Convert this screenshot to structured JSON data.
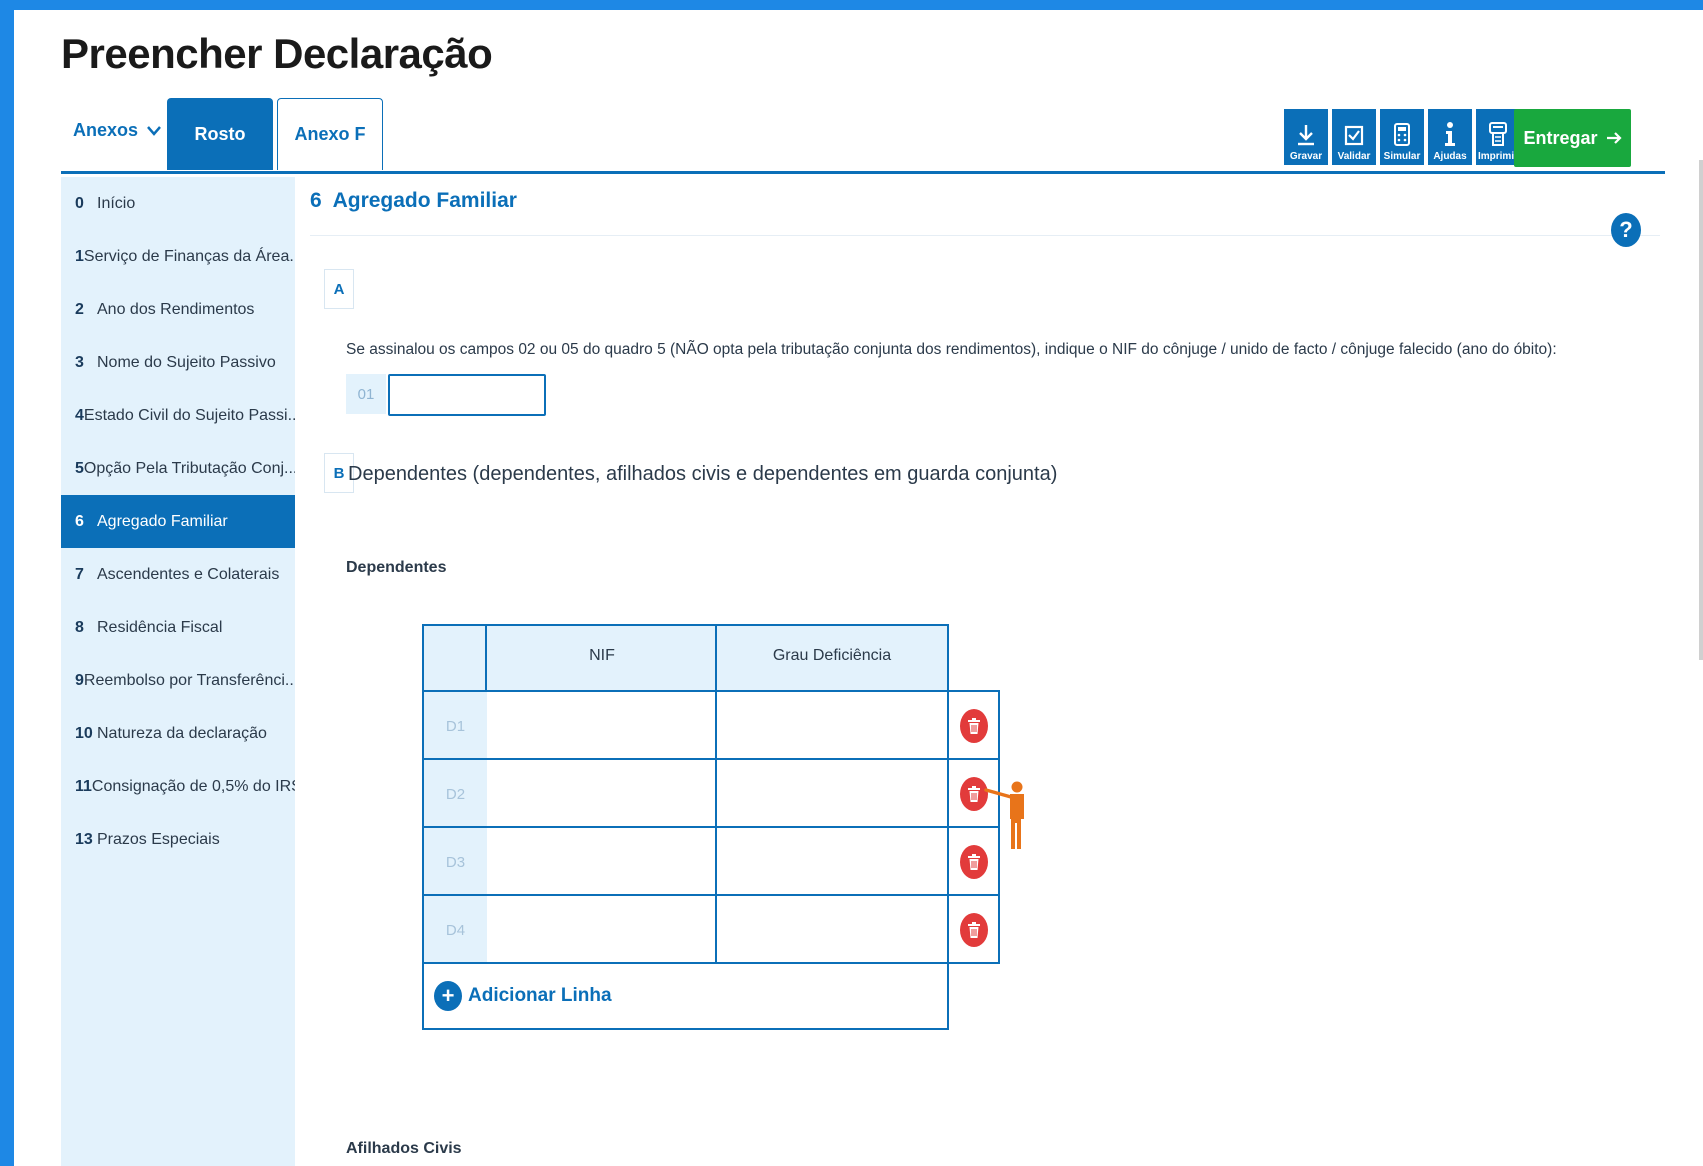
{
  "page": {
    "title": "Preencher Declaração"
  },
  "tabs": {
    "anexos_label": "Anexos",
    "rosto_label": "Rosto",
    "anexo_f_label": "Anexo F"
  },
  "toolbar": {
    "gravar": "Gravar",
    "validar": "Validar",
    "simular": "Simular",
    "ajudas": "Ajudas",
    "imprimir": "Imprimir",
    "entregar": "Entregar"
  },
  "sidebar": {
    "items": [
      {
        "num": "0",
        "label": "Início"
      },
      {
        "num": "1",
        "label": "Serviço de Finanças da Área..."
      },
      {
        "num": "2",
        "label": "Ano dos Rendimentos"
      },
      {
        "num": "3",
        "label": "Nome do Sujeito Passivo"
      },
      {
        "num": "4",
        "label": "Estado Civil do Sujeito Passi..."
      },
      {
        "num": "5",
        "label": "Opção Pela Tributação Conj..."
      },
      {
        "num": "6",
        "label": "Agregado Familiar"
      },
      {
        "num": "7",
        "label": "Ascendentes e Colaterais"
      },
      {
        "num": "8",
        "label": "Residência Fiscal"
      },
      {
        "num": "9",
        "label": "Reembolso por Transferênci..."
      },
      {
        "num": "10",
        "label": "Natureza da declaração"
      },
      {
        "num": "11",
        "label": "Consignação de 0,5% do IRS..."
      },
      {
        "num": "13",
        "label": "Prazos Especiais"
      }
    ],
    "active_index": 6
  },
  "section": {
    "number": "6",
    "title": "Agregado Familiar",
    "help": "?",
    "quadro_a": {
      "letter": "A",
      "instruction": "Se assinalou os campos 02 ou 05 do quadro 5 (NÃO opta pela tributação conjunta dos rendimentos), indique o NIF do cônjuge / unido de facto / cônjuge falecido (ano do óbito):",
      "field_label": "01",
      "field_value": ""
    },
    "quadro_b": {
      "letter": "B",
      "title": "Dependentes (dependentes, afilhados civis e dependentes em guarda conjunta)",
      "dependentes_label": "Dependentes",
      "columns": [
        "NIF",
        "Grau Deficiência"
      ],
      "rows": [
        {
          "label": "D1",
          "nif": "",
          "grau": ""
        },
        {
          "label": "D2",
          "nif": "",
          "grau": ""
        },
        {
          "label": "D3",
          "nif": "",
          "grau": ""
        },
        {
          "label": "D4",
          "nif": "",
          "grau": ""
        }
      ],
      "add_row_label": "Adicionar Linha",
      "afilhados_label": "Afilhados Civis"
    }
  },
  "colors": {
    "primary": "#0b6fb8",
    "sidebar_bg": "#e3f2fc",
    "success": "#19a83e",
    "danger": "#e23b3b",
    "pointer": "#e8741a",
    "frame": "#1e88e5"
  }
}
